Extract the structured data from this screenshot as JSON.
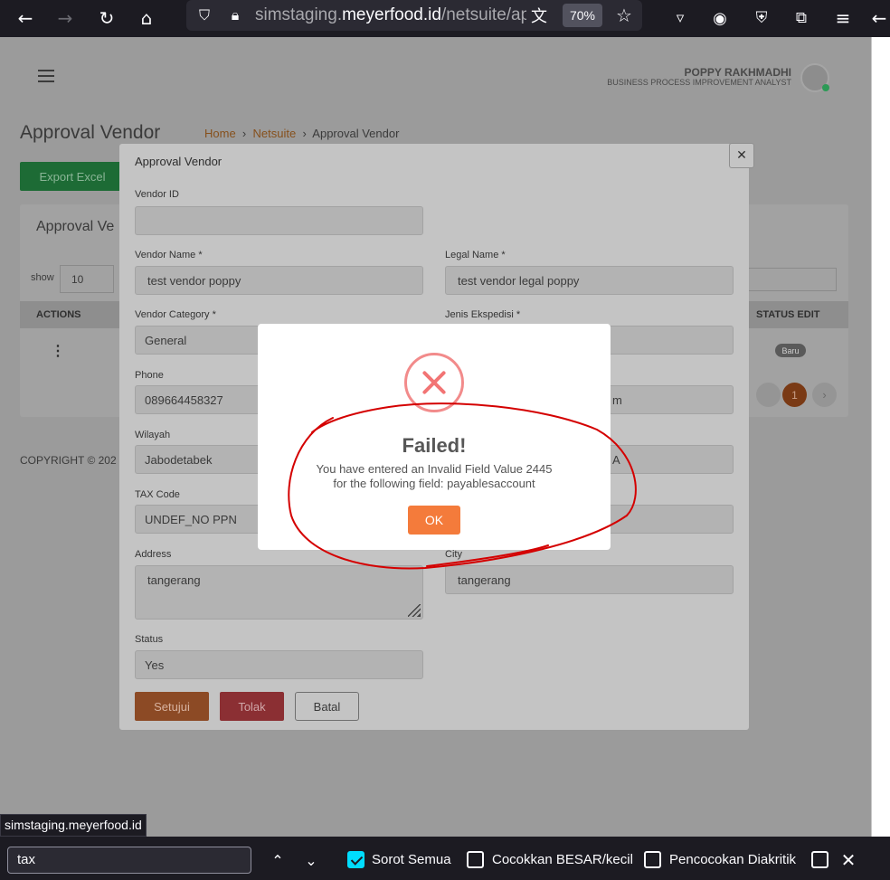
{
  "browser": {
    "url_prefix": "simstaging.",
    "url_domain": "meyerfood.id",
    "url_path": "/netsuite/app",
    "zoom": "70%"
  },
  "app": {
    "user_name": "POPPY RAKHMADHI",
    "user_role": "BUSINESS PROCESS IMPROVEMENT ANALYST",
    "page_title": "Approval Vendor",
    "breadcrumb": [
      "Home",
      "Netsuite",
      "Approval Vendor"
    ],
    "export_label": "Export Excel",
    "card_title": "Approval Ve",
    "show_label": "show",
    "show_value": "10",
    "col_actions": "ACTIONS",
    "col_status": "STATUS EDIT",
    "row_status": "Baru",
    "current_page": "1",
    "copyright": "COPYRIGHT © 202"
  },
  "modal": {
    "title": "Approval Vendor",
    "fields": {
      "vendor_id": {
        "label": "Vendor ID",
        "value": ""
      },
      "vendor_name": {
        "label": "Vendor Name *",
        "value": "test vendor poppy"
      },
      "legal_name": {
        "label": "Legal Name *",
        "value": "test vendor legal poppy"
      },
      "vendor_category": {
        "label": "Vendor Category *",
        "value": "General"
      },
      "jenis_ekspedisi": {
        "label": "Jenis Ekspedisi *",
        "value": ""
      },
      "phone": {
        "label": "Phone",
        "value": "089664458327"
      },
      "email_partial": {
        "value": "m"
      },
      "wilayah": {
        "label": "Wilayah",
        "value": "Jabodetabek"
      },
      "wilayah_right_partial": {
        "value": "A"
      },
      "tax_code": {
        "label": "TAX Code",
        "value": "UNDEF_NO PPN"
      },
      "address": {
        "label": "Address",
        "value": "tangerang"
      },
      "city": {
        "label": "City",
        "value": "tangerang"
      },
      "status": {
        "label": "Status",
        "value": "Yes"
      }
    },
    "approve_label": "Setujui",
    "reject_label": "Tolak",
    "cancel_label": "Batal"
  },
  "alert": {
    "title": "Failed!",
    "message_line1": "You have entered an Invalid Field Value 2445",
    "message_line2": "for the following field: payablesaccount",
    "ok_label": "OK"
  },
  "status_url": "simstaging.meyerfood.id",
  "findbar": {
    "query": "tax",
    "highlight_all": "Sorot Semua",
    "match_case": "Cocokkan BESAR/kecil",
    "match_diacritics": "Pencocokan Diakritik"
  },
  "colors": {
    "accent_orange": "#f47b3b",
    "error_red": "#f27474",
    "export_green": "#1d6b35"
  }
}
